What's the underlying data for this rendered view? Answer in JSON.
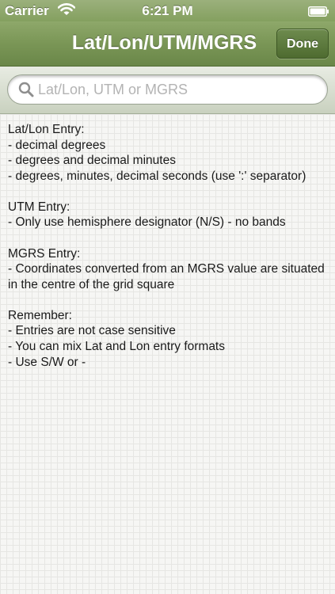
{
  "status_bar": {
    "carrier": "Carrier",
    "time": "6:21 PM",
    "wifi_icon": "wifi-icon",
    "battery_icon": "battery-icon",
    "battery_level": 1.0
  },
  "nav": {
    "title": "Lat/Lon/UTM/MGRS",
    "done_label": "Done"
  },
  "search": {
    "placeholder": "Lat/Lon, UTM or MGRS",
    "value": "",
    "icon": "search-icon"
  },
  "help": {
    "latlon": {
      "heading": "Lat/Lon Entry:",
      "lines": [
        "- decimal degrees",
        "- degrees and decimal minutes",
        "- degrees, minutes, decimal seconds (use ':' separator)"
      ]
    },
    "utm": {
      "heading": "UTM Entry:",
      "lines": [
        "- Only use hemisphere designator (N/S) - no bands"
      ]
    },
    "mgrs": {
      "heading": "MGRS Entry:",
      "lines": [
        "- Coordinates converted from an MGRS value are situated in the centre of the grid square"
      ]
    },
    "remember": {
      "heading": "Remember:",
      "lines": [
        "- Entries are not case sensitive",
        "- You can mix Lat and Lon entry formats",
        "- Use S/W or -"
      ]
    }
  },
  "colors": {
    "nav_green": "#7a9656",
    "done_green": "#5a7a3a",
    "text": "#1a1a1a",
    "placeholder": "#b3b3b3"
  }
}
